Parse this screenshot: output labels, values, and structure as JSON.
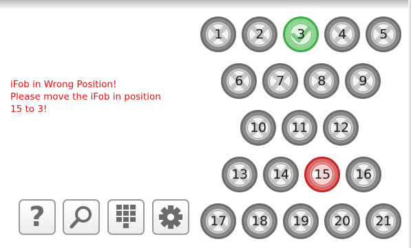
{
  "message": {
    "line1": "iFob in Wrong Position!",
    "line2": "Please move the iFob in position",
    "line3": "15 to 3!"
  },
  "positions": [
    {
      "label": "1",
      "state": "empty"
    },
    {
      "label": "2",
      "state": "empty"
    },
    {
      "label": "3",
      "state": "correct"
    },
    {
      "label": "4",
      "state": "empty"
    },
    {
      "label": "5",
      "state": "empty"
    },
    {
      "label": "6",
      "state": "empty"
    },
    {
      "label": "7",
      "state": "empty"
    },
    {
      "label": "8",
      "state": "empty"
    },
    {
      "label": "9",
      "state": "empty"
    },
    {
      "label": "10",
      "state": "empty"
    },
    {
      "label": "11",
      "state": "empty"
    },
    {
      "label": "12",
      "state": "empty"
    },
    {
      "label": "13",
      "state": "empty"
    },
    {
      "label": "14",
      "state": "empty"
    },
    {
      "label": "15",
      "state": "wrong"
    },
    {
      "label": "16",
      "state": "empty"
    },
    {
      "label": "17",
      "state": "empty"
    },
    {
      "label": "18",
      "state": "empty"
    },
    {
      "label": "19",
      "state": "empty"
    },
    {
      "label": "20",
      "state": "empty"
    },
    {
      "label": "21",
      "state": "empty"
    }
  ],
  "toolbar": [
    {
      "icon": "help-icon",
      "label": "?"
    },
    {
      "icon": "search-icon"
    },
    {
      "icon": "keypad-icon"
    },
    {
      "icon": "settings-icon"
    }
  ],
  "colors": {
    "message": "#e31010",
    "correct": "#3caa45",
    "wrong": "#c42525"
  }
}
